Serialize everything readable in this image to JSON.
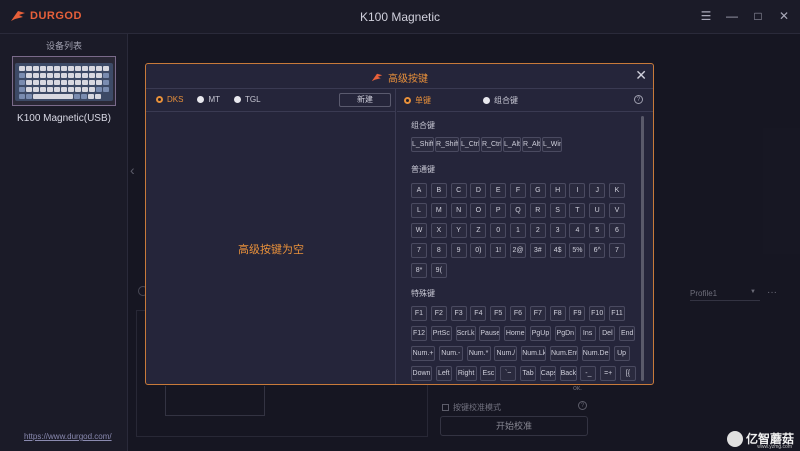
{
  "app": {
    "brand": "DURGOD",
    "title": "K100 Magnetic",
    "window_controls": [
      "☰",
      "—",
      "□",
      "✕"
    ]
  },
  "sidebar": {
    "title": "设备列表",
    "device_name": "K100 Magnetic(USB)",
    "link": "https://www.durgod.com/"
  },
  "background": {
    "profile": "Profile1",
    "more": "···",
    "calibration_mode": "按键校准模式",
    "start_calibration": "开始校准",
    "ok_text": "ок."
  },
  "watermark": {
    "text": "亿智蘑菇",
    "sub": "www.yzmg.com"
  },
  "modal": {
    "title": "高级按键",
    "close": "✕",
    "modes": [
      "DKS",
      "MT",
      "TGL"
    ],
    "new_button": "新建",
    "empty_message": "高级按键为空",
    "key_types": [
      "单键",
      "组合键"
    ],
    "help": "?",
    "sections": {
      "combo": "组合键",
      "normal": "普通键",
      "special": "特殊键"
    },
    "combo_keys": [
      "L_Shift",
      "R_Shift",
      "L_Ctrl",
      "R_Ctrl",
      "L_Alt",
      "R_Alt",
      "L_Win"
    ],
    "normal_keys": [
      [
        "A",
        "B",
        "C",
        "D",
        "E",
        "F",
        "G",
        "H",
        "I",
        "J",
        "K"
      ],
      [
        "L",
        "M",
        "N",
        "O",
        "P",
        "Q",
        "R",
        "S",
        "T",
        "U",
        "V"
      ],
      [
        "W",
        "X",
        "Y",
        "Z",
        "0",
        "1",
        "2",
        "3",
        "4",
        "5",
        "6"
      ],
      [
        "7",
        "8",
        "9",
        "0)",
        "1!",
        "2@",
        "3#",
        "4$",
        "5%",
        "6^",
        "7"
      ],
      [
        "8*",
        "9("
      ]
    ],
    "special_keys": [
      [
        "F1",
        "F2",
        "F3",
        "F4",
        "F5",
        "F6",
        "F7",
        "F8",
        "F9",
        "F10",
        "F11"
      ],
      [
        "F12",
        "PrtSc",
        "ScrLk",
        "Pause",
        "Home",
        "PgUp",
        "PgDn",
        "Ins",
        "Del",
        "End"
      ],
      [
        "Num.+",
        "Num.-",
        "Num.*",
        "Num./",
        "Num.Lk",
        "Num.Ent",
        "Num.Del",
        "Up"
      ],
      [
        "Down",
        "Left",
        "Right",
        "Esc",
        "`~",
        "Tab",
        "Caps",
        "Back",
        "-_",
        "=+",
        "[{"
      ]
    ]
  }
}
